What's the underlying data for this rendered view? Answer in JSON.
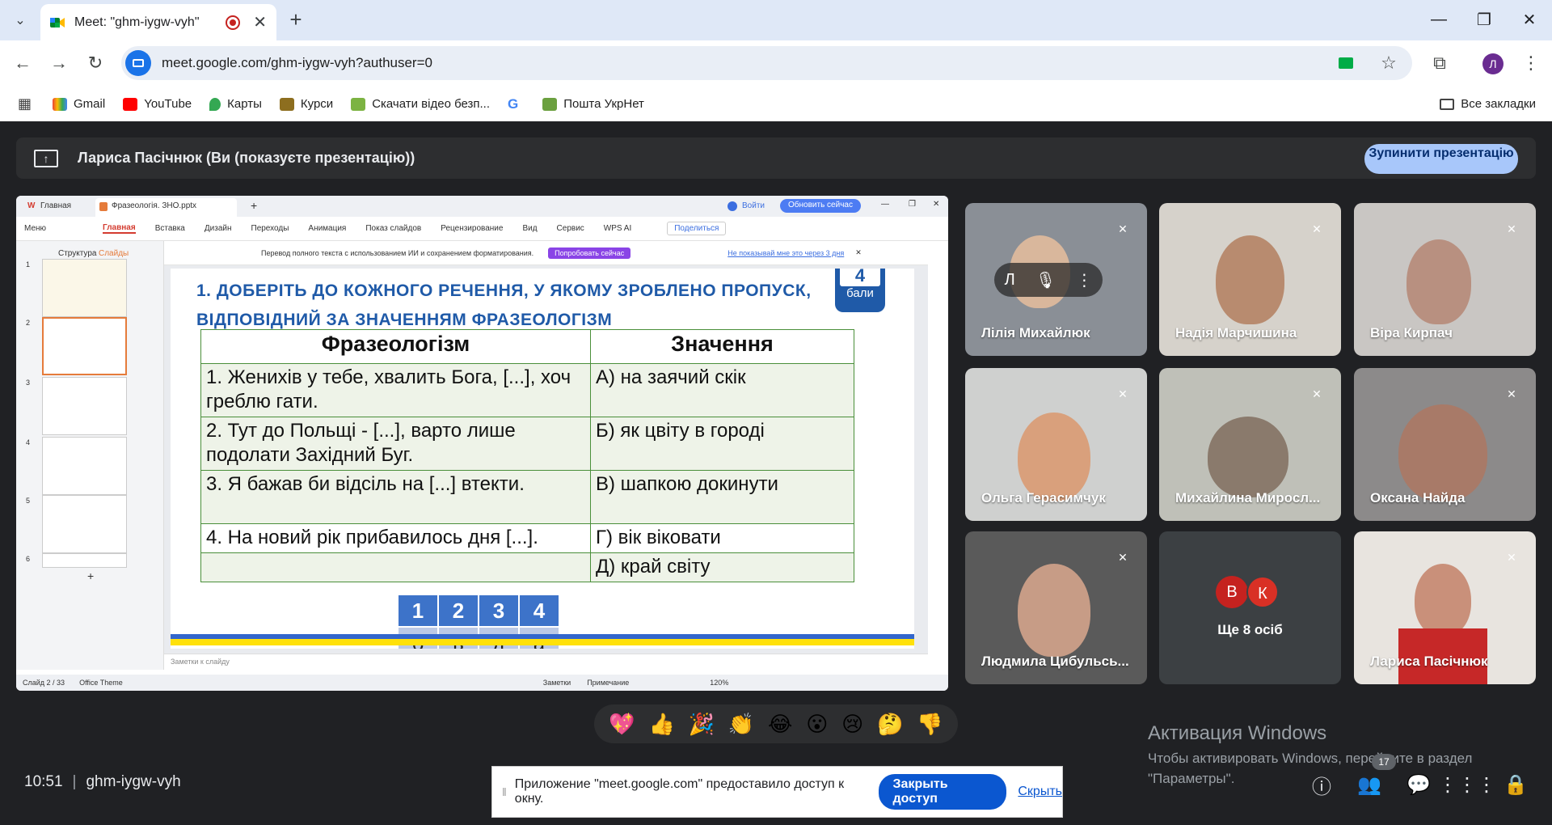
{
  "browser": {
    "tab_title": "Meet: \"ghm-iygw-vyh\"",
    "url": "meet.google.com/ghm-iygw-vyh?authuser=0",
    "profile_initial": "Л",
    "bookmarks": [
      "Gmail",
      "YouTube",
      "Карты",
      "Курси",
      "Скачати відео безп...",
      "Пошта УкрНет"
    ],
    "all_bookmarks": "Все закладки"
  },
  "meet": {
    "presenter_text": "Лариса Пасічнюк (Ви (показуєте презентацію))",
    "stop_presenting": "Зупинити презентацію",
    "time": "10:51",
    "meeting_code": "ghm-iygw-vyh",
    "participants_count": "17",
    "reactions": [
      "💖",
      "👍",
      "🎉",
      "👏",
      "😂",
      "😮",
      "😢",
      "🤔",
      "👎"
    ],
    "tiles": [
      {
        "name": "Лілія Михайлюк",
        "initial": "Л"
      },
      {
        "name": "Надія Марчишина"
      },
      {
        "name": "Віра Кирпач"
      },
      {
        "name": "Ольга Герасимчук"
      },
      {
        "name": "Михайлина Миросл..."
      },
      {
        "name": "Оксана Найда"
      },
      {
        "name": "Людмила Цибульсь..."
      },
      {
        "name": "Ще 8 осіб",
        "avatars": [
          "В",
          "К"
        ]
      },
      {
        "name": "Лариса Пасічнюк"
      }
    ],
    "share_notice": "Приложение \"meet.google.com\" предоставило доступ к окну.",
    "close_access": "Закрыть доступ",
    "hide": "Скрыть"
  },
  "windows": {
    "activate_title": "Активация Windows",
    "activate_text_1": "Чтобы активировать Windows, перейдите в раздел",
    "activate_text_2": "\"Параметры\"."
  },
  "wps": {
    "tab_home": "Главная",
    "tab_file": "Фразеологія. ЗНО.pptx",
    "login": "Войти",
    "update": "Обновить сейчас",
    "menu": "Меню",
    "ribbon": [
      "Главная",
      "Вставка",
      "Дизайн",
      "Переходы",
      "Анимация",
      "Показ слайдов",
      "Рецензирование",
      "Вид",
      "Сервис",
      "WPS AI"
    ],
    "share": "Поделиться",
    "panel_tabs": [
      "Структура",
      "Слайды"
    ],
    "notice": "Перевод полного текста с использованием ИИ и сохранением форматирования.",
    "try_now": "Попробовать сейчас",
    "dont_show": "Не показывай мне это через 3 дня",
    "notes": "Заметки к слайду",
    "status_slide": "Слайд 2 / 33",
    "status_theme": "Office Theme",
    "status_notes": "Заметки",
    "status_comment": "Примечание",
    "zoom": "120%",
    "slide_numbers": [
      "1",
      "2",
      "3",
      "4",
      "5",
      "6"
    ]
  },
  "slide": {
    "title_line1": "1. ДОБЕРІТЬ ДО КОЖНОГО РЕЧЕННЯ, У ЯКОМУ ЗРОБЛЕНО ПРОПУСК,",
    "title_line2": "ВІДПОВІДНИЙ ЗА ЗНАЧЕННЯМ ФРАЗЕОЛОГІЗМ",
    "badge_num": "4",
    "badge_label": "бали",
    "col1": "Фразеологізм",
    "col2": "Значення",
    "rows": [
      {
        "left": "1. Женихів у тебе, хвалить Бога, [...], хоч греблю гати.",
        "right": "А) на заячий скік"
      },
      {
        "left": "2. Тут до Польщі - [...], варто лише подолати Західний Буг.",
        "right": "Б) як цвіту в городі"
      },
      {
        "left": "3. Я бажав би відсіль на [...] втекти.",
        "right": "В) шапкою докинути"
      },
      {
        "left": "4. На новий рік прибавилось дня [...].",
        "right": "Г) вік віковати"
      },
      {
        "left": "",
        "right": "Д) край світу"
      }
    ],
    "answer_numbers": [
      "1",
      "2",
      "3",
      "4"
    ],
    "answer_letters": [
      "б",
      "в",
      "д",
      "а"
    ]
  }
}
